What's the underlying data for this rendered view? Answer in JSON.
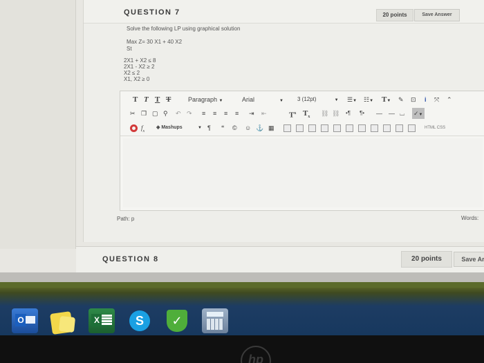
{
  "question7": {
    "title": "QUESTION 7",
    "points": "20 points",
    "save_label": "Save Answer",
    "instruction": "Solve the following LP using graphical solution",
    "objective": "Max Z= 30 X1 + 40 X2",
    "st": "St",
    "constraints": [
      "2X1 + X2 ≤ 8",
      "2X1 - X2 ≥ 2",
      "X2 ≤ 2",
      "X1, X2 ≥ 0"
    ]
  },
  "editor": {
    "paragraph": "Paragraph",
    "font": "Arial",
    "size": "3 (12pt)",
    "mashups": "Mashups",
    "html_css": "HTML CSS",
    "path_label": "Path: p",
    "words_label": "Words:"
  },
  "question8": {
    "title": "QUESTION 8",
    "points": "20 points",
    "save_label": "Save Ar"
  },
  "taskbar": {
    "apps": [
      "outlook-icon",
      "sticky-notes-icon",
      "excel-icon",
      "skype-icon",
      "security-essentials-icon",
      "calculator-icon"
    ]
  },
  "logo": "hp"
}
